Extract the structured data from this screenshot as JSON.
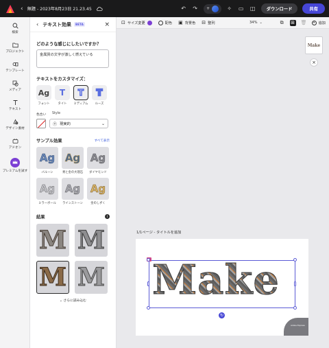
{
  "header": {
    "title": "無題 - 2023年8月23日 21.23.45",
    "download_label": "ダウンロード",
    "share_label": "共有"
  },
  "rail": {
    "items": [
      {
        "label": "検索",
        "icon": "search-icon"
      },
      {
        "label": "プロジェクト",
        "icon": "folder-icon"
      },
      {
        "label": "テンプレート",
        "icon": "templates-icon"
      },
      {
        "label": "メディア",
        "icon": "media-icon"
      },
      {
        "label": "テキスト",
        "icon": "text-icon"
      },
      {
        "label": "デザイン素材",
        "icon": "shapes-icon"
      },
      {
        "label": "アドオン",
        "icon": "addons-icon"
      },
      {
        "label": "プレミアムを試す",
        "icon": "crown-icon"
      }
    ]
  },
  "panel": {
    "title": "テキスト効果",
    "badge": "BETA",
    "question": "どのような感じにしたいですか？",
    "prompt_value": "金属質の文字が激しく燃えている",
    "customize_label": "テキストをカスタマイズ：",
    "styles": [
      {
        "glyph": "Ag",
        "label": "フォント"
      },
      {
        "glyph": "T",
        "label": "タイト"
      },
      {
        "glyph": "T",
        "label": "ミディアム"
      },
      {
        "glyph": "T",
        "label": "ルーズ"
      }
    ],
    "color_label": "色合い",
    "style_label": "Style",
    "style_select": "現実的",
    "samples_label": "サンプル効果",
    "show_all": "すべて表示",
    "samples": [
      {
        "label": "バルーン",
        "color": "#6a88b8"
      },
      {
        "label": "青と金の大理石",
        "color": "#4d6a8f"
      },
      {
        "label": "ダイヤモンド",
        "color": "#8a8a92"
      },
      {
        "label": "ミラーボール",
        "color": "#a0a0a6"
      },
      {
        "label": "ラインストーン",
        "color": "#8e8e96"
      },
      {
        "label": "金のしずく",
        "color": "#b08a3e"
      }
    ],
    "result_label": "結果",
    "results": [
      "M",
      "M",
      "M",
      "M"
    ],
    "load_more": "さらに読み込む"
  },
  "toolbar": {
    "resize_label": "サイズ変更",
    "color_label": "配色",
    "background_label": "背景色",
    "arrange_label": "整列",
    "zoom": "34%",
    "add_label": "追加"
  },
  "canvas": {
    "page_label": "1/1ページ - タイトルを追加",
    "text": "Make",
    "thumb_text": "Make",
    "watermark": "Adobe Express"
  }
}
